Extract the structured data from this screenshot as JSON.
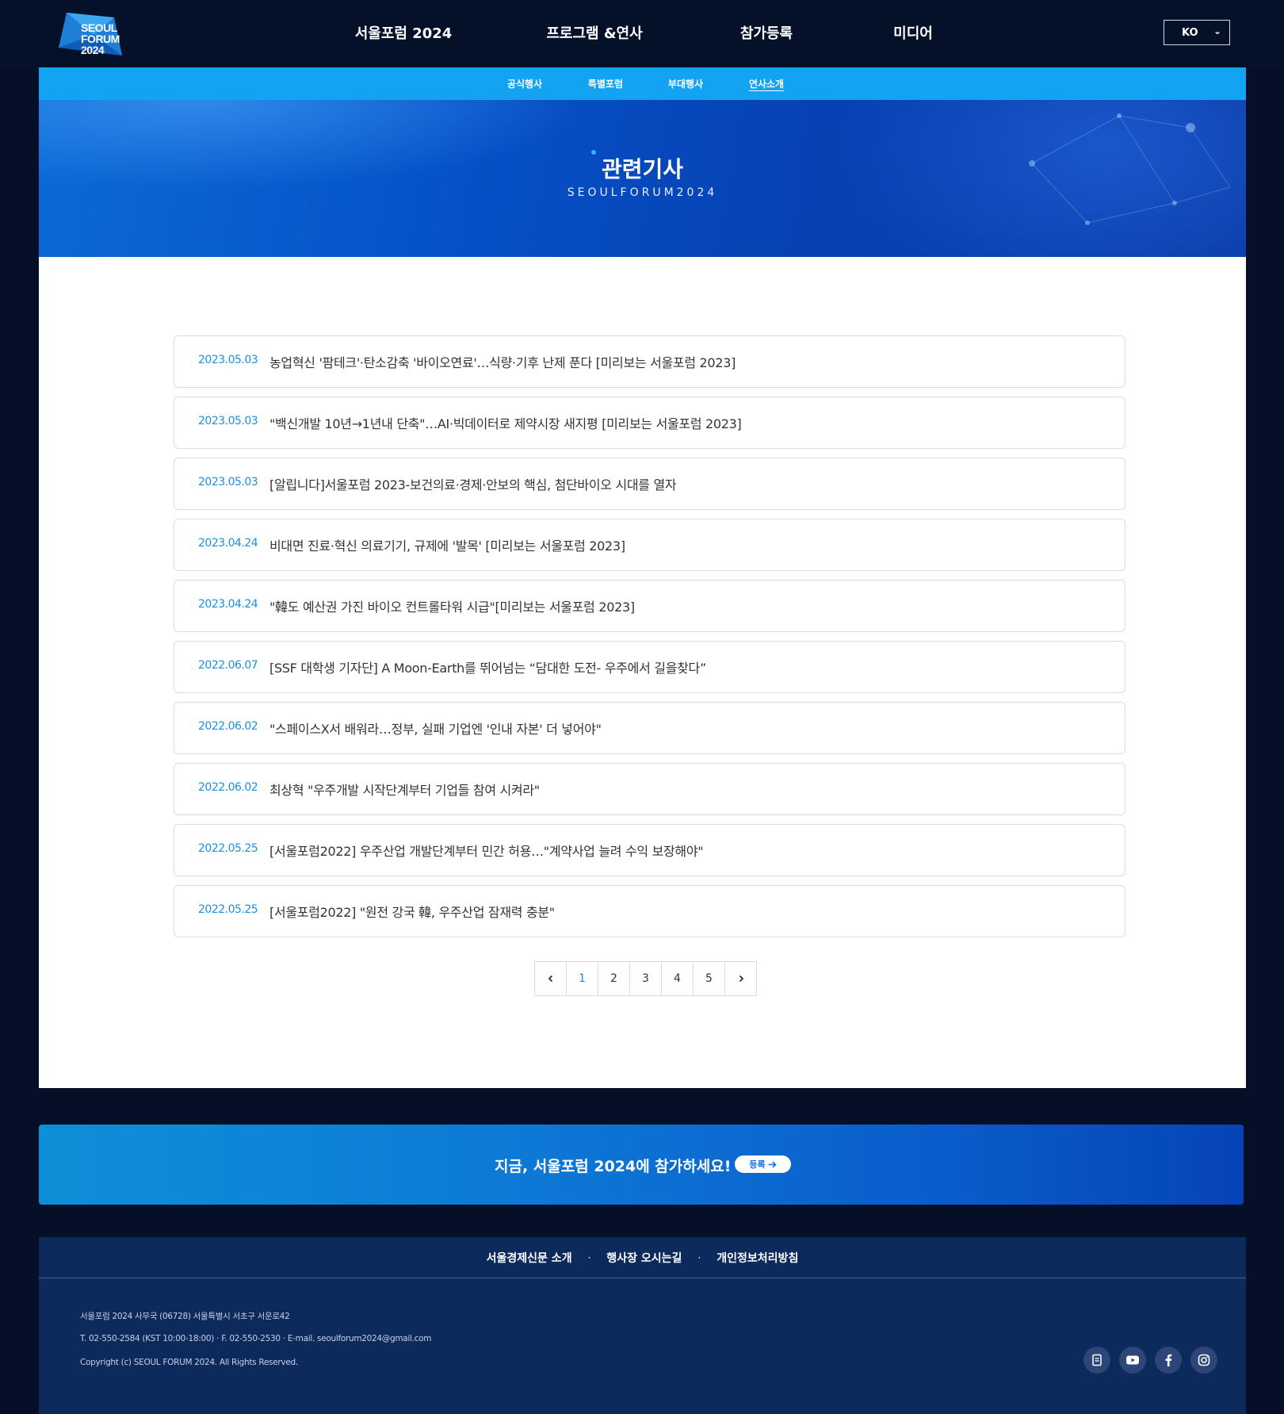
{
  "header": {
    "logo": {
      "line1": "SEOUL",
      "line2": "FORUM 2024"
    },
    "nav": [
      "서울포럼 2024",
      "프로그램 &연사",
      "참가등록",
      "미디어"
    ],
    "lang": "KO"
  },
  "subnav": [
    "공식행사",
    "특별포럼",
    "부대행사",
    "연사소개"
  ],
  "hero": {
    "title": "관련기사",
    "subtitle": "SEOULFORUM2024"
  },
  "articles": [
    {
      "date": "2023.05.03",
      "title": "농업혁신 '팜테크'·탄소감축 '바이오연료'…식량·기후 난제 푼다 [미리보는 서울포럼 2023]"
    },
    {
      "date": "2023.05.03",
      "title": "\"백신개발 10년→1년내 단축\"…AI·빅데이터로 제약시장 새지평 [미리보는 서울포럼 2023]"
    },
    {
      "date": "2023.05.03",
      "title": "[알립니다]서울포럼 2023-보건의료·경제·안보의 핵심, 첨단바이오 시대를 열자"
    },
    {
      "date": "2023.04.24",
      "title": "비대면 진료·혁신 의료기기, 규제에 '발목' [미리보는 서울포럼 2023]"
    },
    {
      "date": "2023.04.24",
      "title": "\"韓도 예산권 가진 바이오 컨트롤타워 시급\"[미리보는 서울포럼 2023]"
    },
    {
      "date": "2022.06.07",
      "title": "[SSF 대학생 기자단] A Moon-Earth를 뛰어넘는 “담대한 도전- 우주에서 길을찾다”"
    },
    {
      "date": "2022.06.02",
      "title": "\"스페이스X서 배워라…정부, 실패 기업엔 '인내 자본' 더 넣어야\""
    },
    {
      "date": "2022.06.02",
      "title": "최상혁 \"우주개발 시작단계부터 기업들 참여 시켜라\""
    },
    {
      "date": "2022.05.25",
      "title": "[서울포럼2022] 우주산업 개발단계부터 민간 허용…\"계약사업 늘려 수익 보장해야\""
    },
    {
      "date": "2022.05.25",
      "title": "[서울포럼2022] \"원전 강국 韓, 우주산업 잠재력 충분\""
    }
  ],
  "pagination": {
    "pages": [
      "1",
      "2",
      "3",
      "4",
      "5"
    ],
    "current": "1",
    "prev_icon": "chevron-left-icon",
    "next_icon": "chevron-right-icon"
  },
  "cta": {
    "text": "지금, 서울포럼 2024에 참가하세요!",
    "button": "등록"
  },
  "footer": {
    "links": [
      "서울경제신문 소개",
      "행사장 오시는길",
      "개인정보처리방침"
    ],
    "address": "서울포럼 2024 사무국 (06728) 서울특별시 서초구 서운로42",
    "contact": "T. 02-550-2584 (KST 10:00-18:00) · F. 02-550-2530 · E-mail. seoulforum2024@gmail.com",
    "copyright": "Copyright (c) SEOUL FORUM 2024. All Rights Reserved.",
    "social": [
      "blog-icon",
      "youtube-icon",
      "facebook-icon",
      "instagram-icon"
    ]
  },
  "colors": {
    "accent": "#12a4f3",
    "date": "#1d8fe0",
    "background": "#050f28",
    "footer": "#0d2a5c"
  }
}
